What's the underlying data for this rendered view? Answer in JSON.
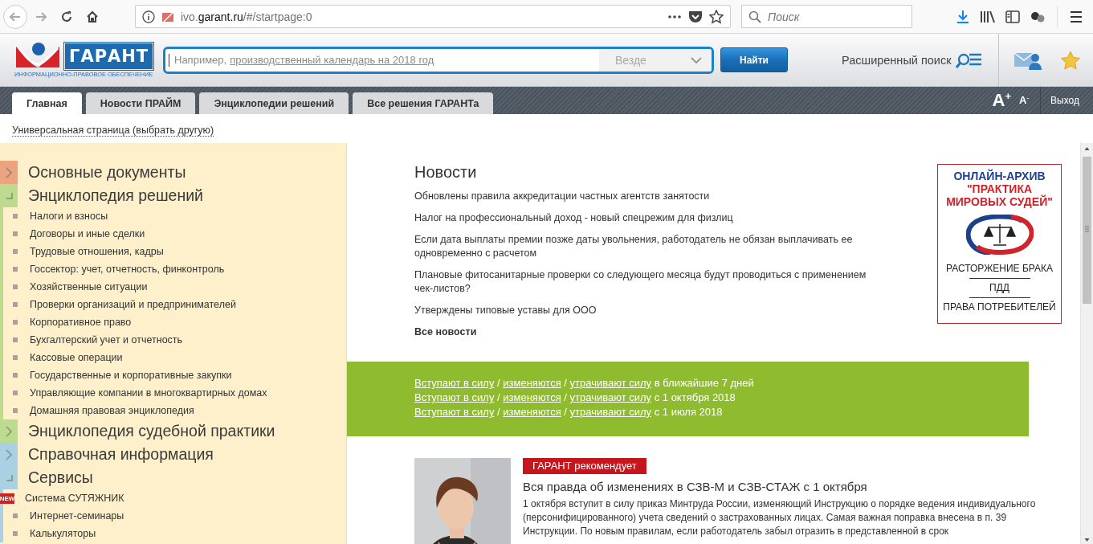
{
  "browser": {
    "url_subdomain": "ivo.",
    "url_domain": "garant.ru",
    "url_path": "/#/startpage:0",
    "search_placeholder": "Поиск"
  },
  "header": {
    "logo_name": "ГАРАНТ",
    "logo_tagline": "ИНФОРМАЦИОННО-ПРАВОВОЕ ОБЕСПЕЧЕНИЕ",
    "search_hint": "Например,",
    "search_example": "производственный календарь на 2018 год",
    "scope": "Везде",
    "find_button": "Найти",
    "advanced_search": "Расширенный поиск"
  },
  "tabs": [
    {
      "label": "Главная",
      "selected": true
    },
    {
      "label": "Новости ПРАЙМ",
      "selected": false
    },
    {
      "label": "Энциклопедии решений",
      "selected": false
    },
    {
      "label": "Все решения ГАРАНТа",
      "selected": false
    }
  ],
  "font_controls": {
    "increase": "A$^{+}$",
    "decrease": "A$^{-}$"
  },
  "exit": "Выход",
  "page_selector": "Универсальная страница (выбрать другую)",
  "sidebar": {
    "sections": [
      {
        "title": "Основные документы",
        "color": "#eba47f",
        "expanded": false
      },
      {
        "title": "Энциклопедия решений",
        "color": "#bcdb8f",
        "expanded": true,
        "items": [
          {
            "label": "Налоги и взносы"
          },
          {
            "label": "Договоры и иные сделки"
          },
          {
            "label": "Трудовые отношения, кадры"
          },
          {
            "label": "Госсектор: учет, отчетность, финконтроль"
          },
          {
            "label": "Хозяйственные ситуации"
          },
          {
            "label": "Проверки организаций и предпринимателей"
          },
          {
            "label": "Корпоративное право"
          },
          {
            "label": "Бухгалтерский учет и отчетность"
          },
          {
            "label": "Кассовые операции"
          },
          {
            "label": "Государственные и корпоративные закупки"
          },
          {
            "label": "Управляющие компании в многоквартирных домах"
          },
          {
            "label": "Домашняя правовая энциклопедия"
          }
        ]
      },
      {
        "title": "Энциклопедия судебной практики",
        "color": "#bcdb8f",
        "expanded": false
      },
      {
        "title": "Справочная информация",
        "color": "#a9d0e3",
        "expanded": false
      },
      {
        "title": "Сервисы",
        "color": "#a9d0e3",
        "expanded": true,
        "items": [
          {
            "label": "Система СУТЯЖНИК",
            "badge": "NEW"
          },
          {
            "label": "Интернет-семинары"
          },
          {
            "label": "Калькуляторы"
          }
        ]
      }
    ]
  },
  "news": {
    "title": "Новости",
    "items": [
      "Обновлены правила аккредитации частных агентств занятости",
      "Налог на профессиональный доход - новый спецрежим для физлиц",
      "Если дата выплаты премии позже даты увольнения, работодатель не обязан выплачивать ее одновременно с расчетом",
      "Плановые фитосанитарные проверки со следующего месяца будут проводиться с применением чек-листов?",
      "Утверждены типовые уставы для ООО"
    ],
    "all_link": "Все новости"
  },
  "ad": {
    "headline": [
      {
        "text": "ОНЛАЙН-АРХИВ",
        "kind": "primary"
      },
      {
        "text": "\"ПРАКТИКА МИРОВЫХ СУДЕЙ\"",
        "kind": "accent"
      }
    ],
    "links": [
      "РАСТОРЖЕНИЕ БРАКА",
      "ПДД",
      "ПРАВА ПОТРЕБИТЕЛЕЙ"
    ]
  },
  "law_changes": {
    "rows": [
      {
        "segments": [
          {
            "text": "Вступают в силу",
            "link": true
          },
          {
            "text": " / ",
            "link": false
          },
          {
            "text": "изменяются",
            "link": true
          },
          {
            "text": " / ",
            "link": false
          },
          {
            "text": "утрачивают силу",
            "link": true
          },
          {
            "text": " в ближайшие 7 дней",
            "link": false
          }
        ]
      },
      {
        "segments": [
          {
            "text": "Вступают в силу",
            "link": true
          },
          {
            "text": " / ",
            "link": false
          },
          {
            "text": "изменяются",
            "link": true
          },
          {
            "text": " / ",
            "link": false
          },
          {
            "text": "утрачивают силу",
            "link": true
          },
          {
            "text": " с 1 октября 2018",
            "link": false
          }
        ]
      },
      {
        "segments": [
          {
            "text": "Вступают в силу",
            "link": true
          },
          {
            "text": " / ",
            "link": false
          },
          {
            "text": "изменяются",
            "link": true
          },
          {
            "text": " / ",
            "link": false
          },
          {
            "text": "утрачивают силу",
            "link": true
          },
          {
            "text": " с 1 июля 2018",
            "link": false
          }
        ]
      }
    ]
  },
  "recommendation": {
    "badge": "ГАРАНТ рекомендует",
    "title": "Вся правда об изменениях в СЗВ-М и СЗВ-СТАЖ с 1 октября",
    "text": "1 октября вступит в силу приказ Минтруда России, изменяющий Инструкцию о порядке ведения индивидуального (персонифицированного) учета сведений о застрахованных лицах. Самая важная поправка внесена в п. 39 Инструкции. По новым правилам, если работодатель забыл отразить в представленной в срок"
  }
}
